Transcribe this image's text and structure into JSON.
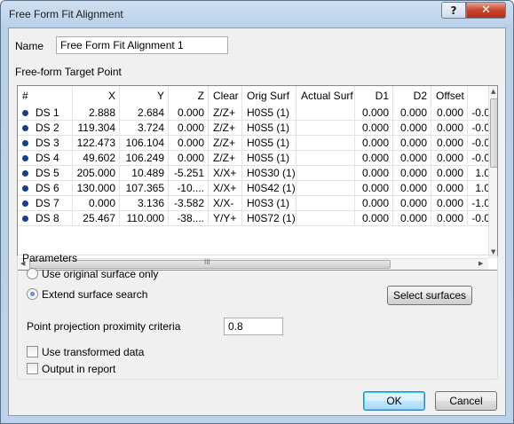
{
  "window": {
    "title": "Free Form Fit Alignment",
    "help_glyph": "?",
    "close_glyph": "✕"
  },
  "name": {
    "label": "Name",
    "value": "Free Form Fit Alignment 1"
  },
  "target": {
    "label": "Free-form Target Point",
    "columns": [
      "#",
      "X",
      "Y",
      "Z",
      "Clear",
      "Orig Surf",
      "Actual Surf",
      "D1",
      "D2",
      "Offset",
      ""
    ],
    "rows": [
      [
        "DS 1",
        "2.888",
        "2.684",
        "0.000",
        "Z/Z+",
        "H0S5 (1)",
        "",
        "0.000",
        "0.000",
        "0.000",
        "-0.0"
      ],
      [
        "DS 2",
        "119.304",
        "3.724",
        "0.000",
        "Z/Z+",
        "H0S5 (1)",
        "",
        "0.000",
        "0.000",
        "0.000",
        "-0.0"
      ],
      [
        "DS 3",
        "122.473",
        "106.104",
        "0.000",
        "Z/Z+",
        "H0S5 (1)",
        "",
        "0.000",
        "0.000",
        "0.000",
        "-0.0"
      ],
      [
        "DS 4",
        "49.602",
        "106.249",
        "0.000",
        "Z/Z+",
        "H0S5 (1)",
        "",
        "0.000",
        "0.000",
        "0.000",
        "-0.0"
      ],
      [
        "DS 5",
        "205.000",
        "10.489",
        "-5.251",
        "X/X+",
        "H0S30 (1)",
        "",
        "0.000",
        "0.000",
        "0.000",
        "1.0"
      ],
      [
        "DS 6",
        "130.000",
        "107.365",
        "-10....",
        "X/X+",
        "H0S42 (1)",
        "",
        "0.000",
        "0.000",
        "0.000",
        "1.0"
      ],
      [
        "DS 7",
        "0.000",
        "3.136",
        "-3.582",
        "X/X-",
        "H0S3 (1)",
        "",
        "0.000",
        "0.000",
        "0.000",
        "-1.0"
      ],
      [
        "DS 8",
        "25.467",
        "110.000",
        "-38....",
        "Y/Y+",
        "H0S72 (1)",
        "",
        "0.000",
        "0.000",
        "0.000",
        "-0.0"
      ]
    ],
    "hscroll_grip": "III"
  },
  "parameters": {
    "label": "Parameters",
    "use_original_label": "Use original surface only",
    "use_original_selected": false,
    "extend_label": "Extend surface search",
    "extend_selected": true,
    "select_surfaces_label": "Select surfaces",
    "proximity_label": "Point projection proximity criteria",
    "proximity_value": "0.8",
    "use_transformed_label": "Use transformed data",
    "use_transformed_checked": false,
    "output_report_label": "Output in report",
    "output_report_checked": false
  },
  "buttons": {
    "ok": "OK",
    "cancel": "Cancel"
  }
}
